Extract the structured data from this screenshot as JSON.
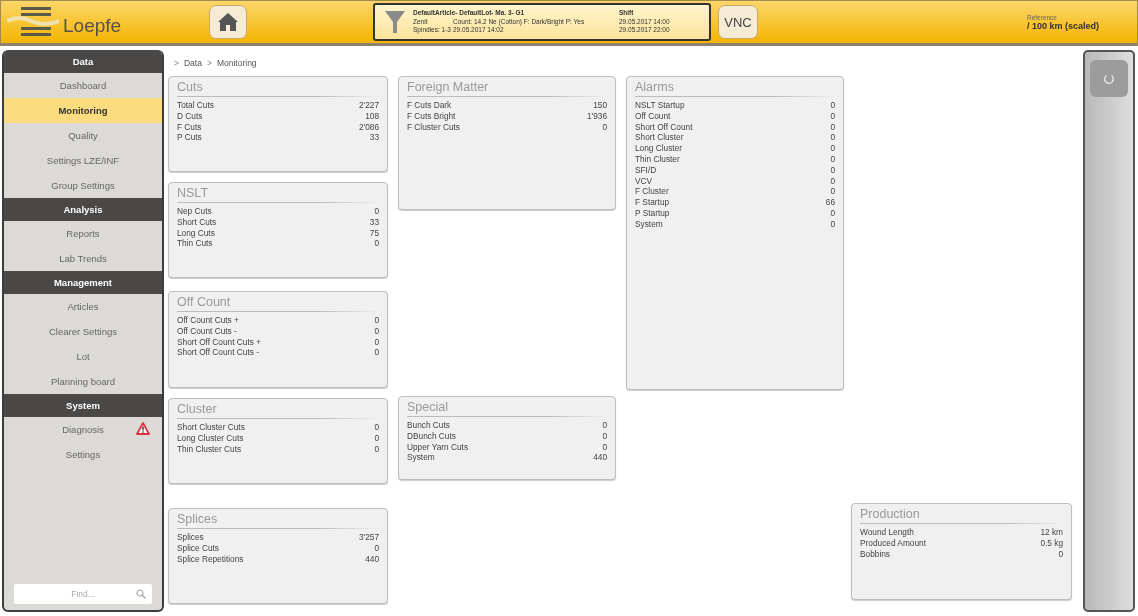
{
  "header": {
    "logo": "Loepfe",
    "info": {
      "title": "DefaultArticle- DefaultLot- Ma. 3- G1",
      "line_1": [
        "Zenit",
        "Count: 14.2 Ne (Cotton) F: Dark/Bright P: Yes"
      ],
      "line_2": [
        "Spindles: 1-3",
        "29.05.2017 14:02"
      ],
      "shift": {
        "title": "Shift",
        "start": "29.05.2017 14:00",
        "end": "29.05.2017 22:00"
      }
    },
    "vnc_button": "VNC",
    "reference": {
      "label": "Reference",
      "value": "/ 100 km (scaled)"
    }
  },
  "sidebar": {
    "sections": [
      {
        "title": "Data",
        "items": [
          {
            "label": "Dashboard",
            "selected": false,
            "alert": false
          },
          {
            "label": "Monitoring",
            "selected": true,
            "alert": false
          },
          {
            "label": "Quality",
            "selected": false,
            "alert": false
          },
          {
            "label": "Settings LZE/INF",
            "selected": false,
            "alert": false
          },
          {
            "label": "Group Settings",
            "selected": false,
            "alert": false
          }
        ]
      },
      {
        "title": "Analysis",
        "items": [
          {
            "label": "Reports",
            "selected": false,
            "alert": false
          },
          {
            "label": "Lab Trends",
            "selected": false,
            "alert": false
          }
        ]
      },
      {
        "title": "Management",
        "items": [
          {
            "label": "Articles",
            "selected": false,
            "alert": false
          },
          {
            "label": "Clearer Settings",
            "selected": false,
            "alert": false
          },
          {
            "label": "Lot",
            "selected": false,
            "alert": false
          },
          {
            "label": "Planning board",
            "selected": false,
            "alert": false
          }
        ]
      },
      {
        "title": "System",
        "items": [
          {
            "label": "Diagnosis",
            "selected": false,
            "alert": true
          },
          {
            "label": "Settings",
            "selected": false,
            "alert": false
          }
        ]
      }
    ],
    "search": {
      "placeholder": "Find..."
    }
  },
  "breadcrumb": {
    "separator": ">",
    "items": [
      "Data",
      "Monitoring"
    ]
  },
  "cards": [
    {
      "title": "Cuts",
      "rows": [
        [
          "Total Cuts",
          "2'227"
        ],
        [
          "D Cuts",
          "108"
        ],
        [
          "F Cuts",
          "2'086"
        ],
        [
          "P Cuts",
          "33"
        ]
      ]
    },
    {
      "title": "Foreign Matter",
      "rows": [
        [
          "F Cuts Dark",
          "150"
        ],
        [
          "F Cuts Bright",
          "1'936"
        ],
        [
          "F Cluster Cuts",
          "0"
        ]
      ]
    },
    {
      "title": "Alarms",
      "rows": [
        [
          "NSLT Startup",
          "0"
        ],
        [
          "Off Count",
          "0"
        ],
        [
          "Short Off Count",
          "0"
        ],
        [
          "Short Cluster",
          "0"
        ],
        [
          "Long Cluster",
          "0"
        ],
        [
          "Thin Cluster",
          "0"
        ],
        [
          "SFI/D",
          "0"
        ],
        [
          "VCV",
          "0"
        ],
        [
          "F Cluster",
          "0"
        ],
        [
          "F Startup",
          "66"
        ],
        [
          "P Startup",
          "0"
        ],
        [
          "System",
          "0"
        ]
      ]
    },
    {
      "title": "NSLT",
      "rows": [
        [
          "Nep Cuts",
          "0"
        ],
        [
          "Short Cuts",
          "33"
        ],
        [
          "Long Cuts",
          "75"
        ],
        [
          "Thin Cuts",
          "0"
        ]
      ]
    },
    {
      "title": "Off Count",
      "rows": [
        [
          "Off Count Cuts +",
          "0"
        ],
        [
          "Off Count Cuts -",
          "0"
        ],
        [
          "Short Off Count Cuts +",
          "0"
        ],
        [
          "Short Off Count Cuts -",
          "0"
        ]
      ]
    },
    {
      "title": "Cluster",
      "rows": [
        [
          "Short Cluster Cuts",
          "0"
        ],
        [
          "Long Cluster Cuts",
          "0"
        ],
        [
          "Thin Cluster Cuts",
          "0"
        ]
      ]
    },
    {
      "title": "Special",
      "rows": [
        [
          "Bunch Cuts",
          "0"
        ],
        [
          "DBunch Cuts",
          "0"
        ],
        [
          "Upper Yarn Cuts",
          "0"
        ],
        [
          "System",
          "440"
        ]
      ]
    },
    {
      "title": "Splices",
      "rows": [
        [
          "Splices",
          "3'257"
        ],
        [
          "Splice Cuts",
          "0"
        ],
        [
          "Splice Repetitions",
          "440"
        ]
      ]
    },
    {
      "title": "Production",
      "rows": [
        [
          "Wound Length",
          "12 km"
        ],
        [
          "Produced Amount",
          "0.5 kg"
        ],
        [
          "Bobbins",
          "0"
        ]
      ]
    }
  ]
}
